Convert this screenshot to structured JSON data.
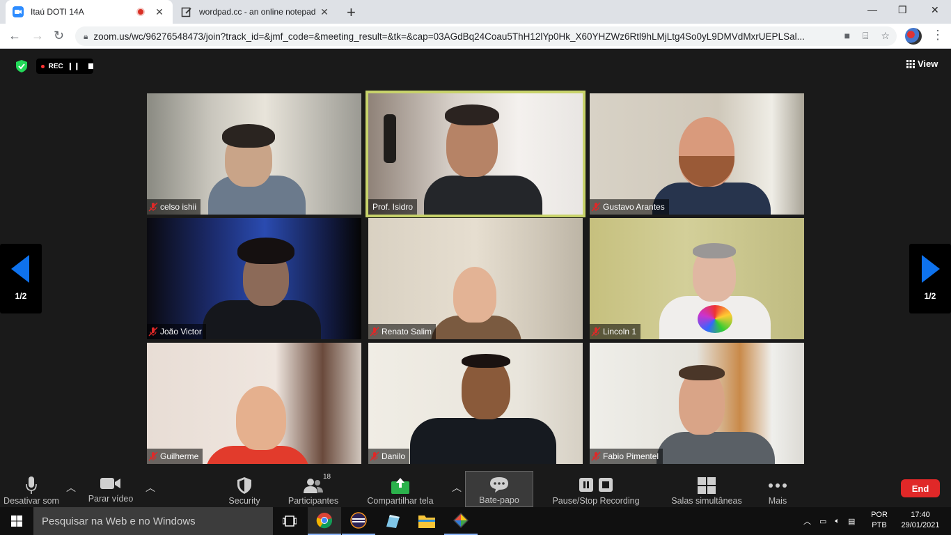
{
  "browser": {
    "tabs": [
      {
        "title": "Itaú DOTI 14A",
        "active": true
      },
      {
        "title": "wordpad.cc - an online notepad",
        "active": false
      }
    ],
    "url": "zoom.us/wc/96276548473/join?track_id=&jmf_code=&meeting_result=&tk=&cap=03AGdBq24Coau5ThH12lYp0Hk_X60YHZWz6Rtl9hLMjLtg4So0yL9DMVdMxrUEPLSal..."
  },
  "meeting": {
    "rec_label": "REC",
    "view_label": "View",
    "page_indicator": "1/2",
    "participants": [
      {
        "name": "celso ishii",
        "muted": true,
        "active_speaker": false
      },
      {
        "name": "Prof. Isidro",
        "muted": false,
        "active_speaker": true
      },
      {
        "name": "Gustavo Arantes",
        "muted": true,
        "active_speaker": false
      },
      {
        "name": "João Victor",
        "muted": true,
        "active_speaker": false
      },
      {
        "name": "Renato Salim",
        "muted": true,
        "active_speaker": false
      },
      {
        "name": "Lincoln 1",
        "muted": true,
        "active_speaker": false
      },
      {
        "name": "Guilherme",
        "muted": true,
        "active_speaker": false
      },
      {
        "name": "Danilo",
        "muted": true,
        "active_speaker": false
      },
      {
        "name": "Fabio Pimentel",
        "muted": true,
        "active_speaker": false
      }
    ]
  },
  "toolbar": {
    "mute": "Desativar som",
    "video": "Parar vídeo",
    "security": "Security",
    "participants": "Participantes",
    "participants_count": "18",
    "share": "Compartilhar tela",
    "chat": "Bate-papo",
    "recording": "Pause/Stop Recording",
    "breakout": "Salas simultâneas",
    "more": "Mais",
    "end": "End"
  },
  "taskbar": {
    "search_placeholder": "Pesquisar na Web e no Windows",
    "lang_top": "POR",
    "lang_bottom": "PTB",
    "time": "17:40",
    "date": "29/01/2021"
  },
  "colors": {
    "active_speaker_border": "#c8d36b",
    "end_button": "#e02828",
    "share_green": "#2bb24c",
    "arrow_blue": "#0e72ed"
  }
}
